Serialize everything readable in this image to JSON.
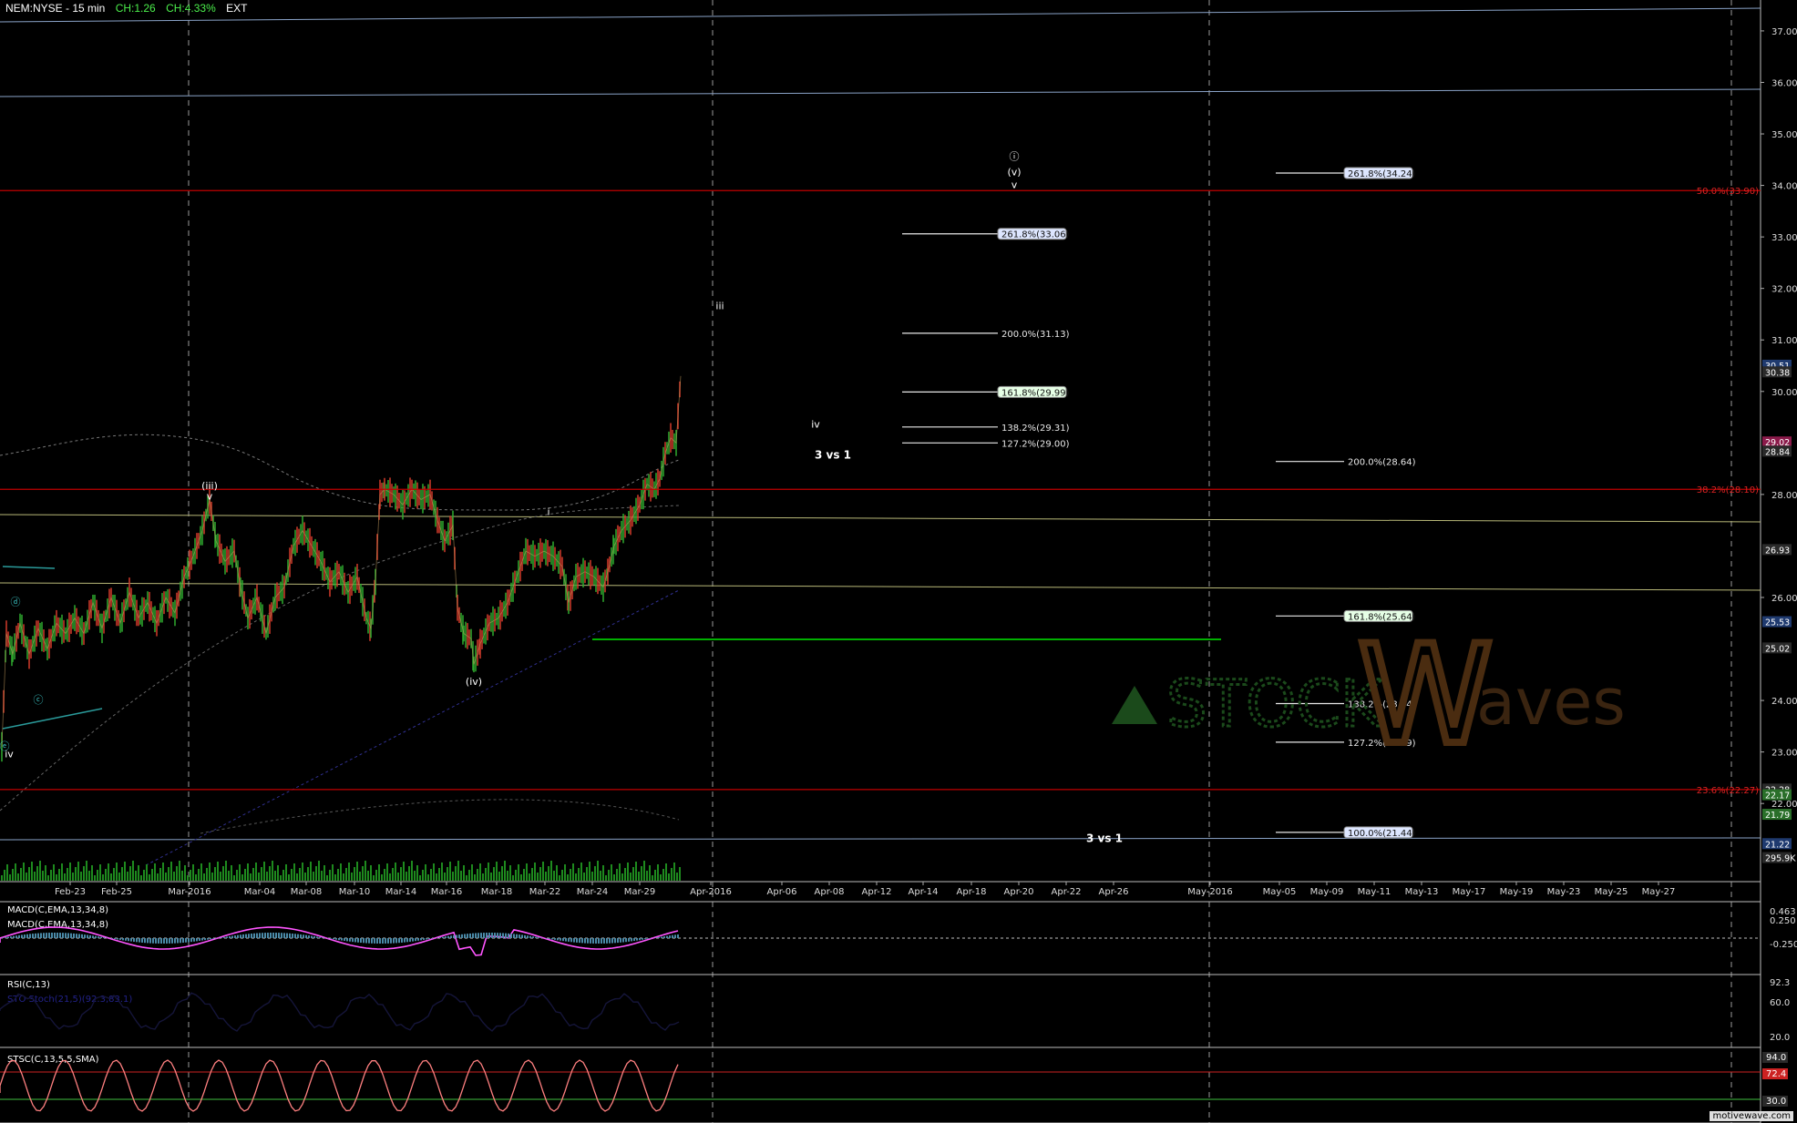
{
  "header": {
    "symbol": "NEM:NYSE - 15 min",
    "change": "CH:1.26",
    "change_pct": "CH:4.33%",
    "session": "EXT"
  },
  "watermark": {
    "brand_left": "STOCK",
    "brand_w": "W",
    "brand_right": "aves",
    "credit": "motivewave.com"
  },
  "colors": {
    "background": "#000000",
    "fib_red": "#c00000",
    "guide_blue": "#8aa3c8",
    "guide_yellow": "#b8b878",
    "support_green": "#00b000",
    "macd": "#ff55ff",
    "rsi": "#4a4ae0",
    "stoch": "#ff8080",
    "stoch_band_green": "#40c040"
  },
  "chart_data": {
    "type": "candlestick",
    "title": "NEM:NYSE - 15 min",
    "x_ticks": [
      "Feb-23",
      "Feb-25",
      "Mar-2016",
      "Mar-04",
      "Mar-08",
      "Mar-10",
      "Mar-14",
      "Mar-16",
      "Mar-18",
      "Mar-22",
      "Mar-24",
      "Mar-29",
      "Apr-2016",
      "Apr-06",
      "Apr-08",
      "Apr-12",
      "Apr-14",
      "Apr-18",
      "Apr-20",
      "Apr-22",
      "Apr-26",
      "May-2016",
      "May-05",
      "May-09",
      "May-11",
      "May-13",
      "May-17",
      "May-19",
      "May-23",
      "May-25",
      "May-27"
    ],
    "y_ticks": [
      37.0,
      36.0,
      35.0,
      34.0,
      33.0,
      32.0,
      31.0,
      30.0,
      28.0,
      26.0,
      24.0,
      23.0,
      22.0
    ],
    "ylim": [
      20.5,
      37.6
    ],
    "price_path": [
      [
        0,
        23.1
      ],
      [
        5,
        25.3
      ],
      [
        12,
        24.9
      ],
      [
        20,
        25.5
      ],
      [
        30,
        24.9
      ],
      [
        40,
        25.4
      ],
      [
        50,
        25.0
      ],
      [
        60,
        25.5
      ],
      [
        70,
        25.3
      ],
      [
        80,
        25.6
      ],
      [
        90,
        25.3
      ],
      [
        100,
        25.9
      ],
      [
        110,
        25.4
      ],
      [
        120,
        26.0
      ],
      [
        130,
        25.5
      ],
      [
        140,
        26.1
      ],
      [
        150,
        25.6
      ],
      [
        160,
        25.9
      ],
      [
        170,
        25.5
      ],
      [
        180,
        26.0
      ],
      [
        190,
        25.7
      ],
      [
        200,
        26.4
      ],
      [
        210,
        26.8
      ],
      [
        220,
        27.3
      ],
      [
        228,
        27.9
      ],
      [
        235,
        27.1
      ],
      [
        245,
        26.7
      ],
      [
        255,
        26.9
      ],
      [
        262,
        26.2
      ],
      [
        270,
        25.6
      ],
      [
        280,
        26.0
      ],
      [
        290,
        25.3
      ],
      [
        300,
        26.0
      ],
      [
        310,
        26.2
      ],
      [
        320,
        27.0
      ],
      [
        330,
        27.3
      ],
      [
        340,
        27.0
      ],
      [
        350,
        26.7
      ],
      [
        360,
        26.3
      ],
      [
        370,
        26.5
      ],
      [
        380,
        26.1
      ],
      [
        390,
        26.4
      ],
      [
        400,
        25.6
      ],
      [
        405,
        25.4
      ],
      [
        410,
        26.3
      ],
      [
        415,
        28.0
      ],
      [
        420,
        28.1
      ],
      [
        430,
        28.0
      ],
      [
        440,
        27.8
      ],
      [
        450,
        28.1
      ],
      [
        460,
        27.9
      ],
      [
        470,
        28.0
      ],
      [
        478,
        27.5
      ],
      [
        486,
        27.1
      ],
      [
        495,
        27.4
      ],
      [
        500,
        25.8
      ],
      [
        507,
        25.3
      ],
      [
        515,
        25.2
      ],
      [
        518,
        24.7
      ],
      [
        525,
        25.1
      ],
      [
        535,
        25.5
      ],
      [
        545,
        25.6
      ],
      [
        555,
        25.9
      ],
      [
        565,
        26.4
      ],
      [
        575,
        26.9
      ],
      [
        585,
        26.8
      ],
      [
        595,
        26.9
      ],
      [
        605,
        26.8
      ],
      [
        615,
        26.6
      ],
      [
        622,
        25.9
      ],
      [
        630,
        26.4
      ],
      [
        640,
        26.5
      ],
      [
        650,
        26.4
      ],
      [
        660,
        26.2
      ],
      [
        665,
        26.5
      ],
      [
        672,
        27.0
      ],
      [
        680,
        27.3
      ],
      [
        690,
        27.5
      ],
      [
        700,
        27.8
      ],
      [
        708,
        28.2
      ],
      [
        716,
        28.1
      ],
      [
        722,
        28.3
      ],
      [
        728,
        28.8
      ],
      [
        734,
        29.1
      ],
      [
        740,
        29.0
      ],
      [
        745,
        30.3
      ]
    ],
    "volume": "bars",
    "fib_levels": [
      {
        "label": "50.0%(33.90)",
        "value": 33.9,
        "color": "red"
      },
      {
        "label": "38.2%(28.10)",
        "value": 28.1,
        "color": "red"
      },
      {
        "label": "23.6%(22.27)",
        "value": 22.27,
        "color": "red"
      }
    ],
    "projections": [
      {
        "label": "261.8%(33.06)",
        "value": 33.06,
        "group": "near",
        "boxed": true,
        "box": "blue"
      },
      {
        "label": "200.0%(31.13)",
        "value": 31.13,
        "group": "near"
      },
      {
        "label": "161.8%(29.99)",
        "value": 29.99,
        "group": "near",
        "boxed": true,
        "box": "green"
      },
      {
        "label": "138.2%(29.31)",
        "value": 29.31,
        "group": "near"
      },
      {
        "label": "127.2%(29.00)",
        "value": 29.0,
        "group": "near"
      },
      {
        "label": "261.8%(34.24)",
        "value": 34.24,
        "group": "far",
        "boxed": true,
        "box": "blue"
      },
      {
        "label": "200.0%(28.64)",
        "value": 28.64,
        "group": "far"
      },
      {
        "label": "161.8%(25.64)",
        "value": 25.64,
        "group": "far",
        "boxed": true,
        "box": "green"
      },
      {
        "label": "138.2%(23.94)",
        "value": 23.94,
        "group": "far"
      },
      {
        "label": "127.2%(23.19)",
        "value": 23.19,
        "group": "far"
      },
      {
        "label": "100.0%(21.44)",
        "value": 21.44,
        "group": "far",
        "boxed": true,
        "box": "blue"
      }
    ],
    "wave_labels": [
      {
        "text": "(iii)",
        "bar": 228,
        "value": 28.1
      },
      {
        "text": "v",
        "bar": 228,
        "value": 27.9
      },
      {
        "text": "(iv)",
        "bar": 518,
        "value": 24.3
      },
      {
        "text": "i",
        "bar": 600,
        "value": 27.6
      },
      {
        "text": "iii",
        "bar": 788,
        "value": 31.6
      },
      {
        "text": "iv",
        "bar": 893,
        "value": 29.3
      },
      {
        "text": "3 vs 1",
        "bar": 912,
        "value": 28.7
      },
      {
        "text": "3 vs 1",
        "bar": 1210,
        "value": 21.25
      },
      {
        "text": "ⓘ",
        "bar": 1111,
        "value": 34.5
      },
      {
        "text": "(v)",
        "bar": 1111,
        "value": 34.2
      },
      {
        "text": "v",
        "bar": 1111,
        "value": 33.95
      },
      {
        "text": "iv",
        "bar": 8,
        "value": 22.9
      },
      {
        "text": "ⓓ",
        "bar": 15,
        "value": 25.85
      },
      {
        "text": "ⓒ",
        "bar": 40,
        "value": 23.95
      },
      {
        "text": "ⓔ",
        "bar": 3,
        "value": 23.05
      }
    ],
    "price_tags": [
      {
        "text": "30.51",
        "value": 30.51,
        "bg": "#1f3a6f"
      },
      {
        "text": "30.38",
        "value": 30.38,
        "bg": "#2a2a2a"
      },
      {
        "text": "29.02",
        "value": 29.02,
        "bg": "#8b1a4a"
      },
      {
        "text": "28.84",
        "value": 28.84,
        "bg": "#2a2a2a"
      },
      {
        "text": "26.93",
        "value": 26.93,
        "bg": "#2a2a2a"
      },
      {
        "text": "25.53",
        "value": 25.53,
        "bg": "#1f3a6f"
      },
      {
        "text": "25.02",
        "value": 25.02,
        "bg": "#2a2a2a"
      },
      {
        "text": "22.28",
        "value": 22.28,
        "bg": "#2a2a2a"
      },
      {
        "text": "22.17",
        "value": 22.17,
        "bg": "#2a6f2a"
      },
      {
        "text": "21.79",
        "value": 21.79,
        "bg": "#2a6f2a"
      },
      {
        "text": "21.22",
        "value": 21.22,
        "bg": "#1f3a6f"
      },
      {
        "text": "295.9K",
        "value": 20.95,
        "bg": "#2a2a2a"
      }
    ],
    "indicators": {
      "macd": {
        "label": "MACD(C,EMA,13,34,8)",
        "ticks": [
          "0.463",
          "0.250",
          "-0.250"
        ]
      },
      "rsi": {
        "label": "RSI(C,13)",
        "sublabel": "STO Stoch(21,5)(92.3,83.1)",
        "ticks": [
          "92.3",
          "60.0",
          "20.0"
        ]
      },
      "stoch": {
        "label": "STSC(C,13,5,5,SMA)",
        "ticks": [
          "94.0",
          "72.4",
          "30.0"
        ]
      }
    }
  }
}
